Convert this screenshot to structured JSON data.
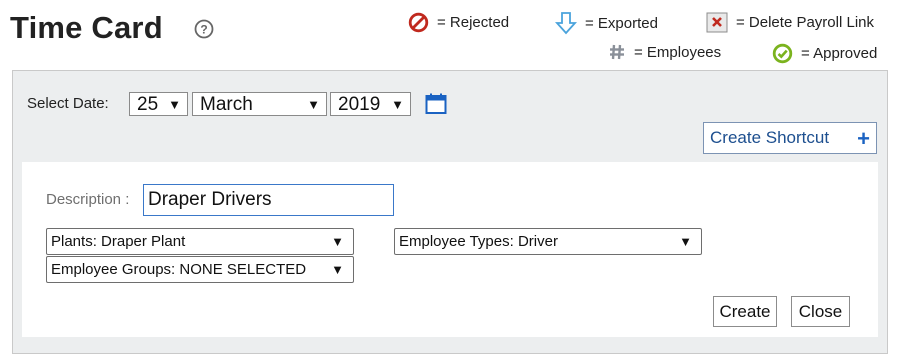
{
  "header": {
    "title": "Time Card",
    "help_icon": "question-circle-icon"
  },
  "legend": {
    "rejected": {
      "label": "= Rejected",
      "icon": "rejected-icon",
      "color": "#c0291e"
    },
    "exported": {
      "label": "= Exported",
      "icon": "arrow-down-icon",
      "color": "#4aa3dc"
    },
    "delete_payroll_link": {
      "label": "= Delete Payroll Link",
      "icon": "delete-x-icon",
      "color": "#c0291e"
    },
    "employees": {
      "label": "= Employees",
      "icon": "hash-icon",
      "color": "#8a9099"
    },
    "approved": {
      "label": "= Approved",
      "icon": "approved-icon",
      "color": "#7bb31e"
    }
  },
  "date_selector": {
    "label": "Select Date:",
    "day": "25",
    "month": "March",
    "year": "2019",
    "calendar_icon": "calendar-icon"
  },
  "create_shortcut": {
    "label": "Create Shortcut",
    "icon": "plus-icon",
    "accent": "#1a62c2"
  },
  "form": {
    "description_label": "Description :",
    "description_value": "Draper Drivers",
    "plants": "Plants: Draper Plant",
    "employee_types": "Employee Types: Driver",
    "employee_groups": "Employee Groups: NONE SELECTED",
    "create_label": "Create",
    "close_label": "Close"
  }
}
